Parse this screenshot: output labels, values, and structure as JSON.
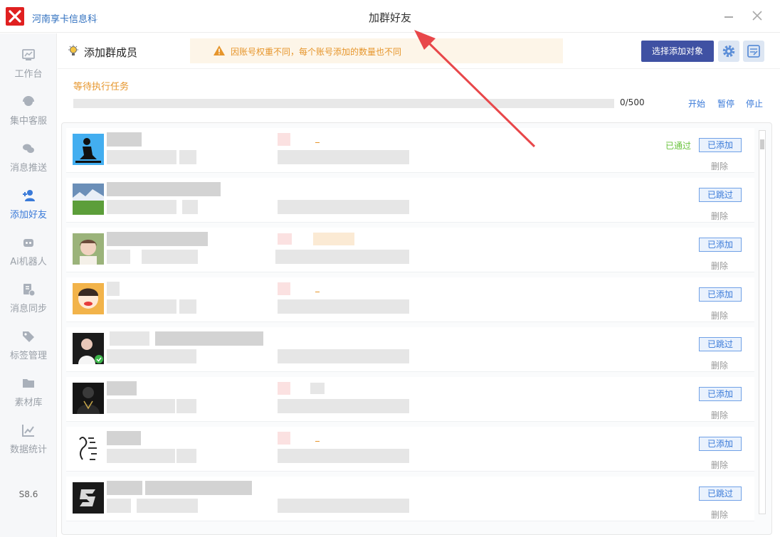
{
  "window": {
    "company": "河南享卡信息科技",
    "title": "加群好友"
  },
  "sidebar": {
    "items": [
      {
        "label": "工作台",
        "icon": "dashboard-icon"
      },
      {
        "label": "集中客服",
        "icon": "customer-service-icon"
      },
      {
        "label": "消息推送",
        "icon": "chat-bubbles-icon"
      },
      {
        "label": "添加好友",
        "icon": "add-user-icon"
      },
      {
        "label": "Ai机器人",
        "icon": "robot-icon"
      },
      {
        "label": "消息同步",
        "icon": "sync-document-icon"
      },
      {
        "label": "标签管理",
        "icon": "tag-icon"
      },
      {
        "label": "素材库",
        "icon": "folder-icon"
      },
      {
        "label": "数据统计",
        "icon": "line-chart-icon"
      }
    ],
    "active_index": 3,
    "version": "S8.6"
  },
  "header": {
    "title": "添加群成员",
    "warning": "因账号权重不同，每个账号添加的数量也不同",
    "select_button": "选择添加对象"
  },
  "task": {
    "label": "等待执行任务",
    "progress_text": "0/500",
    "progress_fraction": 0,
    "start": "开始",
    "pause": "暂停",
    "stop": "停止"
  },
  "members": [
    {
      "status": "已通过",
      "tag": "已添加",
      "delete": "删除"
    },
    {
      "status": "",
      "tag": "已跳过",
      "delete": "删除"
    },
    {
      "status": "",
      "tag": "已添加",
      "delete": "删除"
    },
    {
      "status": "",
      "tag": "已添加",
      "delete": "删除"
    },
    {
      "status": "",
      "tag": "已跳过",
      "delete": "删除"
    },
    {
      "status": "",
      "tag": "已添加",
      "delete": "删除"
    },
    {
      "status": "",
      "tag": "已添加",
      "delete": "删除"
    },
    {
      "status": "",
      "tag": "已跳过",
      "delete": "删除"
    }
  ],
  "colors": {
    "accent": "#3a7ad8",
    "primary_button": "#3f51a3",
    "warning": "#e6952b",
    "success": "#67c23a",
    "annotation_arrow": "#e8474a"
  }
}
